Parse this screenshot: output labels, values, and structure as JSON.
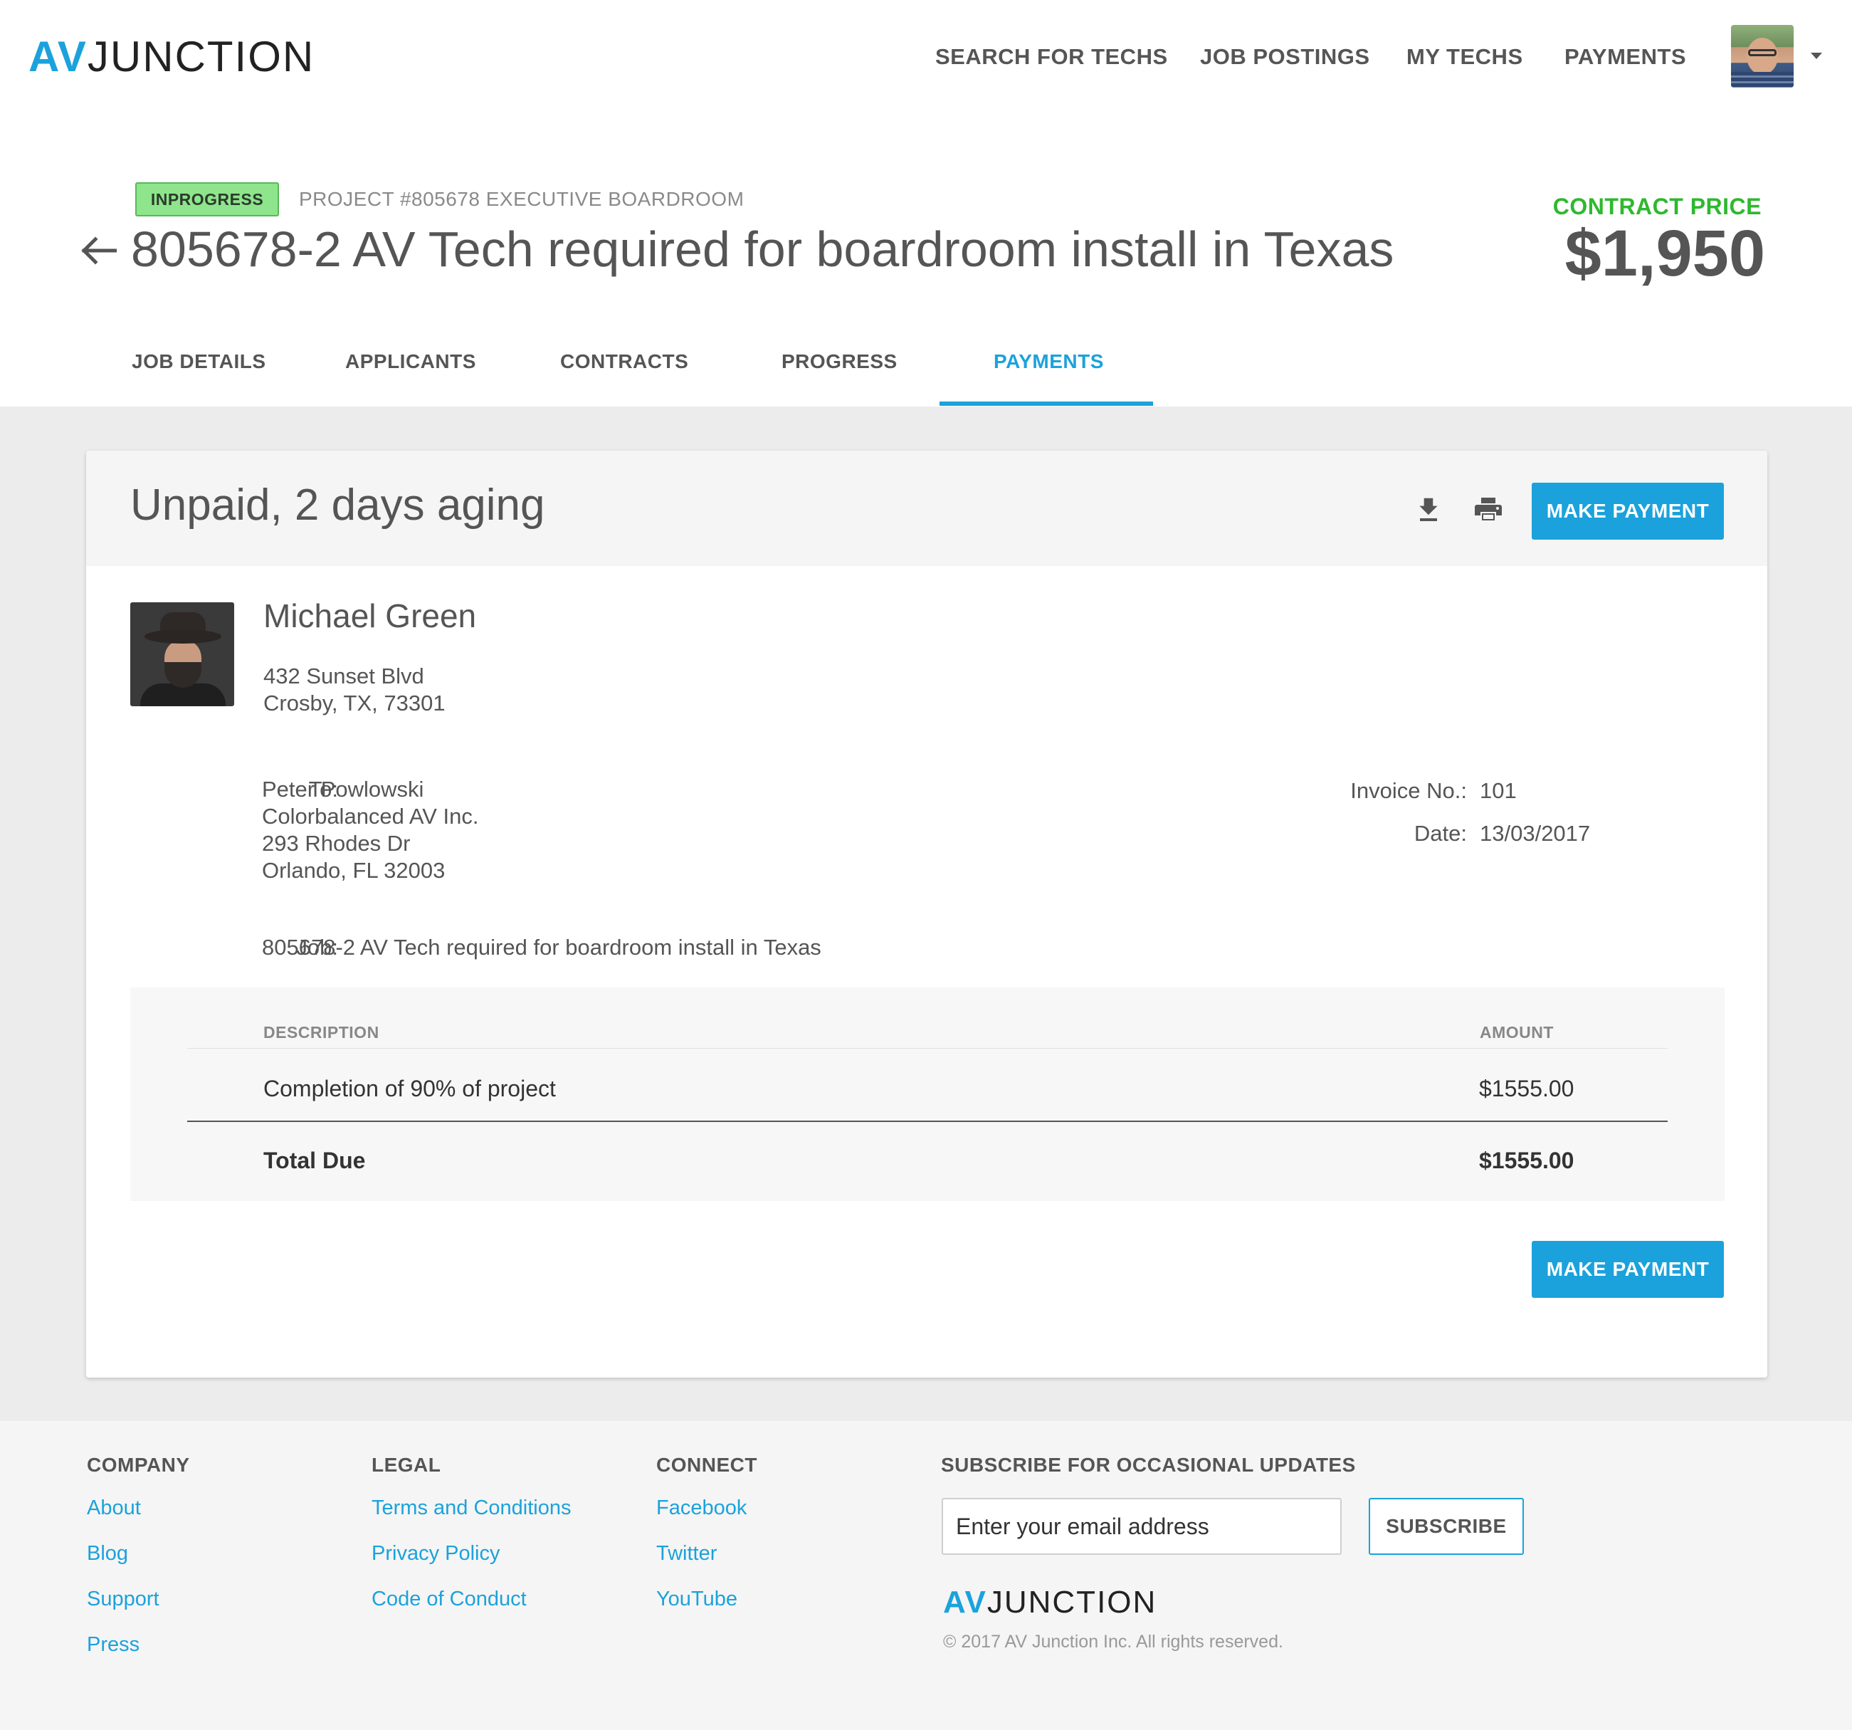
{
  "brand": {
    "logo_av": "AV",
    "logo_rest": "JUNCTION",
    "accent_color": "#1ba2dc",
    "success_color": "#2eb82e"
  },
  "nav": {
    "links": [
      "SEARCH FOR TECHS",
      "JOB POSTINGS",
      "MY TECHS",
      "PAYMENTS"
    ],
    "avatar_icon": "user-avatar",
    "dropdown_icon": "caret-down-icon"
  },
  "project": {
    "status_badge": "INPROGRESS",
    "label": "PROJECT #805678 EXECUTIVE BOARDROOM",
    "title": "805678-2 AV Tech required for boardroom install in Texas",
    "contract_price_label": "CONTRACT PRICE",
    "contract_price": "$1,950",
    "back_icon": "back-arrow-icon"
  },
  "tabs": {
    "items": [
      "JOB DETAILS",
      "APPLICANTS",
      "CONTRACTS",
      "PROGRESS",
      "PAYMENTS"
    ],
    "active": "PAYMENTS"
  },
  "invoice": {
    "status_title": "Unpaid, 2 days aging",
    "download_icon": "download-icon",
    "print_icon": "print-icon",
    "make_payment_label": "MAKE PAYMENT",
    "from": {
      "name": "Michael Green",
      "address_line1": "432 Sunset Blvd",
      "address_line2": "Crosby, TX, 73301"
    },
    "to_label": "To:",
    "to": {
      "name": "Peter Powlowski",
      "company": "Colorbalanced AV Inc.",
      "address_line1": "293 Rhodes Dr",
      "address_line2": "Orlando, FL 32003"
    },
    "invoice_no_label": "Invoice No.:",
    "invoice_no": "101",
    "date_label": "Date:",
    "date": "13/03/2017",
    "job_label": "Job:",
    "job": "805678-2 AV Tech required for boardroom install in Texas",
    "columns": {
      "description": "DESCRIPTION",
      "amount": "AMOUNT"
    },
    "items": [
      {
        "description": "Completion of 90% of project",
        "amount": "$1555.00"
      }
    ],
    "total_label": "Total Due",
    "total": "$1555.00"
  },
  "footer": {
    "company": {
      "heading": "COMPANY",
      "links": [
        "About",
        "Blog",
        "Support",
        "Press"
      ]
    },
    "legal": {
      "heading": "LEGAL",
      "links": [
        "Terms and Conditions",
        "Privacy Policy",
        "Code of Conduct"
      ]
    },
    "connect": {
      "heading": "CONNECT",
      "links": [
        "Facebook",
        "Twitter",
        "YouTube"
      ]
    },
    "subscribe": {
      "heading": "SUBSCRIBE FOR OCCASIONAL UPDATES",
      "placeholder": "Enter your email address",
      "button_label": "SUBSCRIBE"
    },
    "logo_av": "AV",
    "logo_rest": "JUNCTION",
    "copyright": "© 2017 AV Junction Inc. All rights reserved."
  }
}
